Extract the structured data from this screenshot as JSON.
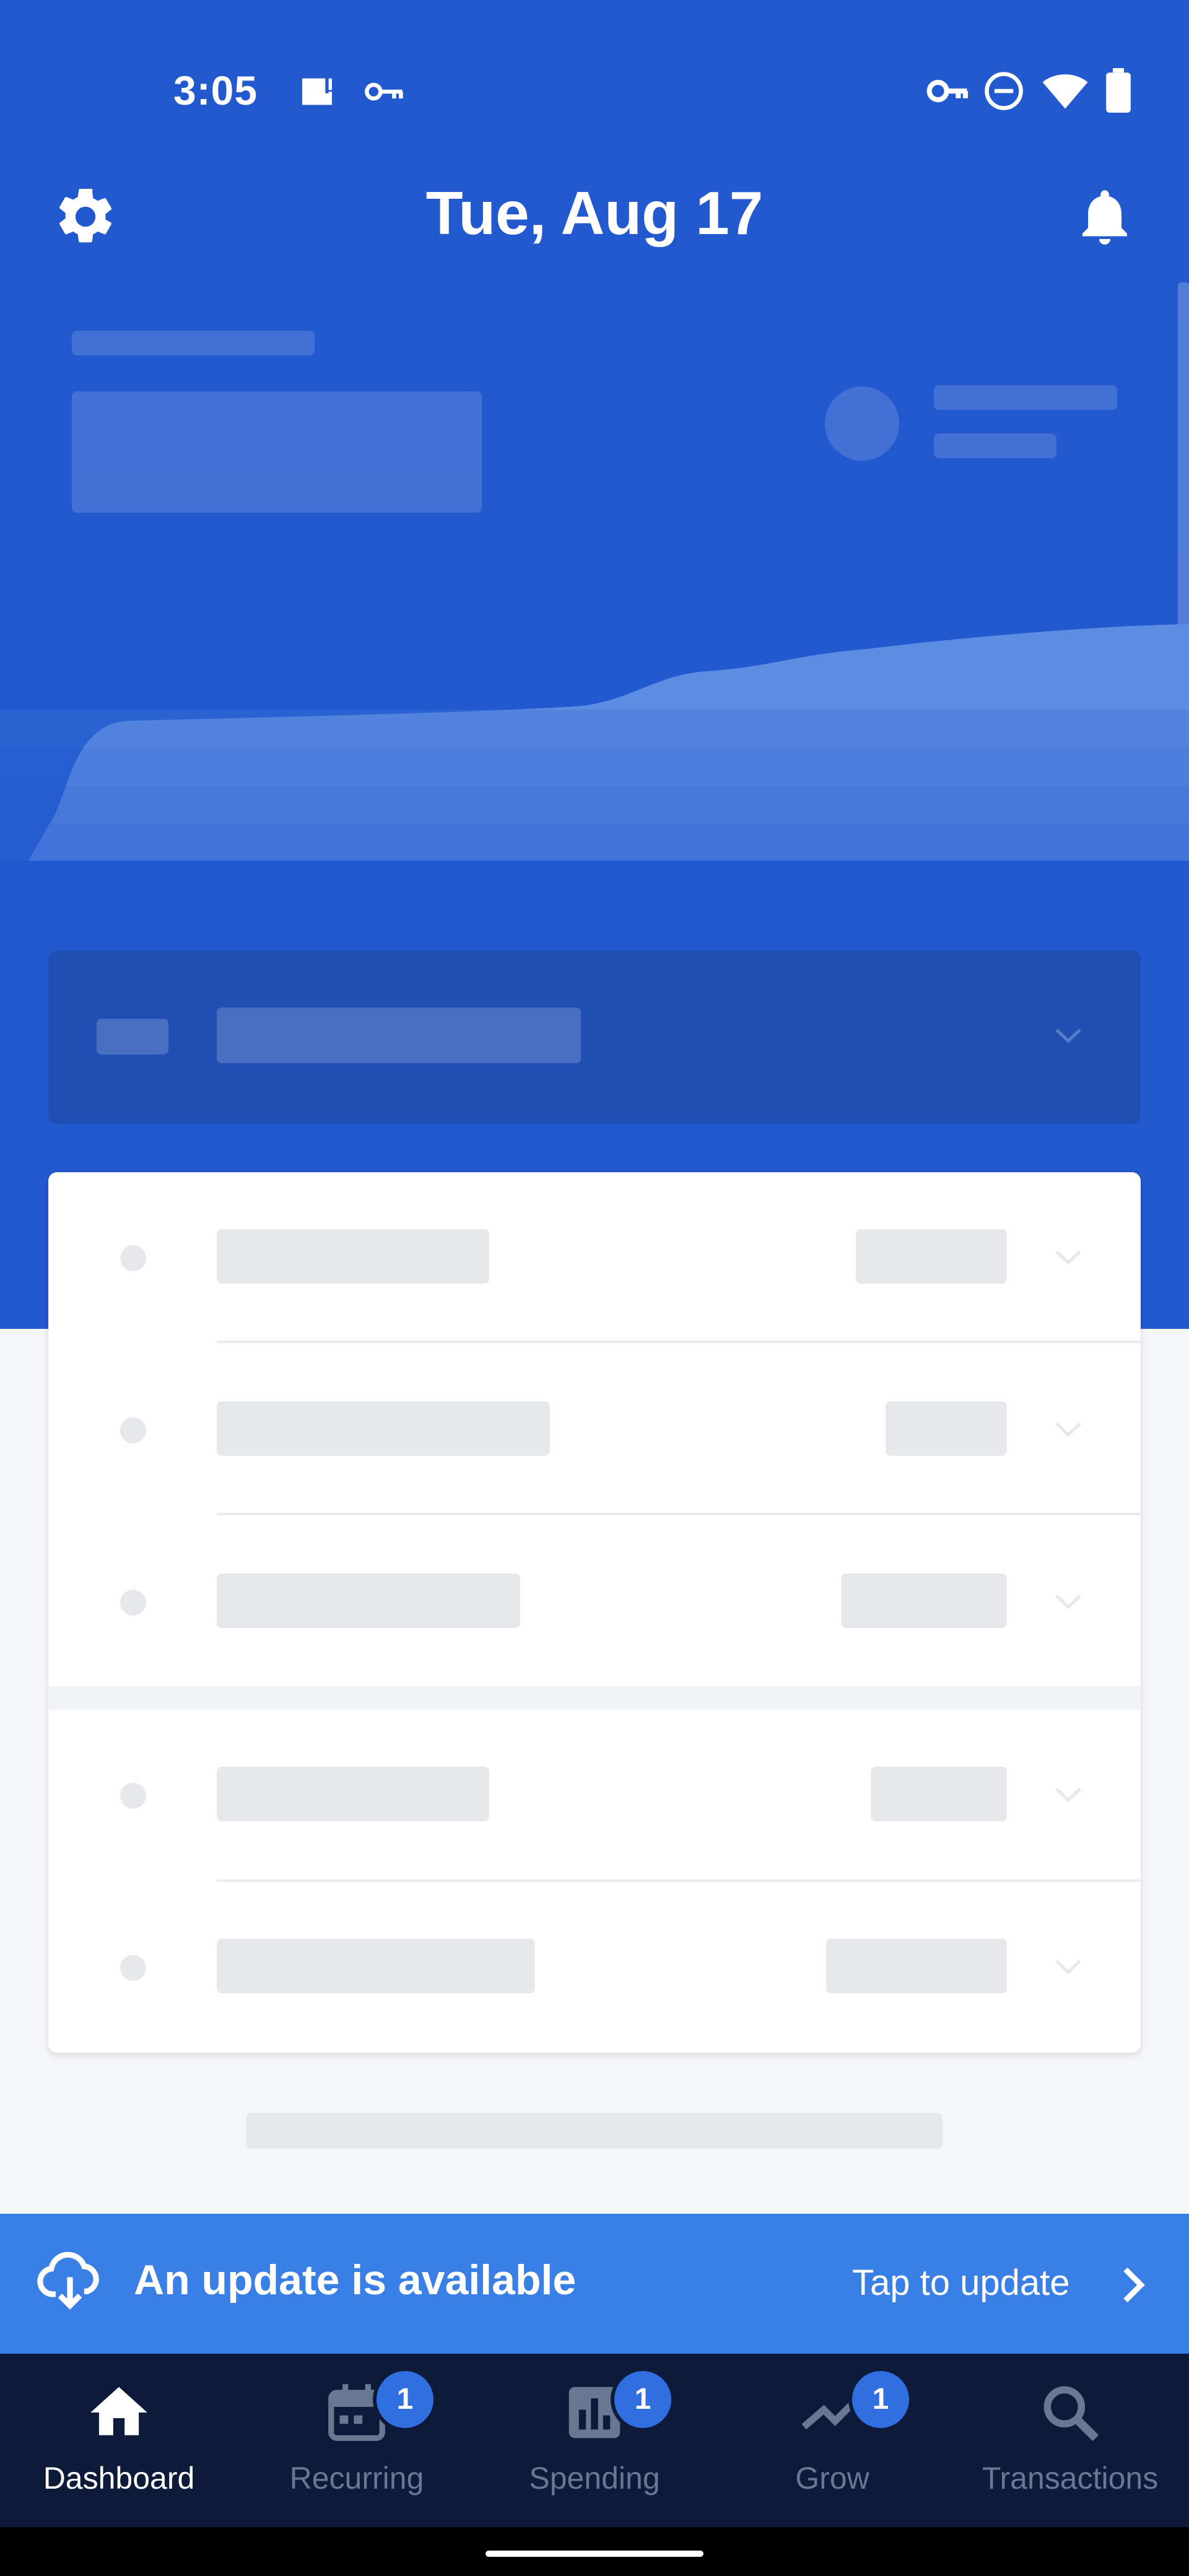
{
  "status_bar": {
    "time": "3:05",
    "left_icons": [
      "image-alert-icon",
      "key-icon"
    ],
    "right_icons": [
      "vpn-key-icon",
      "do-not-disturb-icon",
      "wifi-icon",
      "battery-icon"
    ]
  },
  "header": {
    "title": "Tue, Aug 17",
    "left_icon": "gear-icon",
    "right_icon": "bell-icon"
  },
  "update_banner": {
    "message": "An update is available",
    "action": "Tap to update",
    "icon": "cloud-download-icon"
  },
  "bottom_nav": {
    "items": [
      {
        "label": "Dashboard",
        "icon": "home-icon",
        "active": true,
        "badge": ""
      },
      {
        "label": "Recurring",
        "icon": "calendar-icon",
        "active": false,
        "badge": "1"
      },
      {
        "label": "Spending",
        "icon": "bar-chart-icon",
        "active": false,
        "badge": "1"
      },
      {
        "label": "Grow",
        "icon": "trend-icon",
        "active": false,
        "badge": "1"
      },
      {
        "label": "Transactions",
        "icon": "search-icon",
        "active": false,
        "badge": ""
      }
    ]
  },
  "colors": {
    "hero_blue": "#2359cf",
    "banner_blue": "#3a7fe6",
    "nav_bg": "#0e1a3a",
    "badge_blue": "#2f6fe0"
  }
}
